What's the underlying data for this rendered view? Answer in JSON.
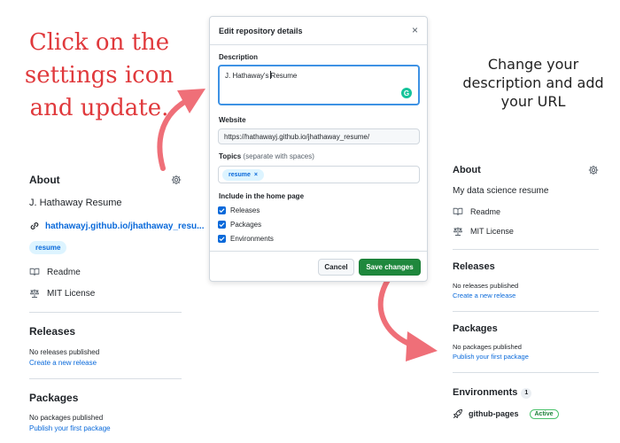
{
  "annotations": {
    "left_instruction": "Click on the settings icon and update.",
    "right_instruction": "Change your description and add your URL"
  },
  "left_sidebar": {
    "about": {
      "heading": "About",
      "description": "J. Hathaway Resume",
      "website": "hathawayj.github.io/jhathaway_resu...",
      "topic": "resume",
      "readme": "Readme",
      "license": "MIT License"
    },
    "releases": {
      "heading": "Releases",
      "empty": "No releases published",
      "link": "Create a new release"
    },
    "packages": {
      "heading": "Packages",
      "empty": "No packages published",
      "link": "Publish your first package"
    }
  },
  "dialog": {
    "title": "Edit repository details",
    "description_label": "Description",
    "description_value_before_caret": "J. Hathaway's",
    "description_value_after_caret": "Resume",
    "grammarly_glyph": "G",
    "website_label": "Website",
    "website_value": "https://hathawayj.github.io/jhathaway_resume/",
    "topics_label": "Topics",
    "topics_hint": "(separate with spaces)",
    "topics": [
      "resume"
    ],
    "topic_remove_glyph": "×",
    "include_label": "Include in the home page",
    "checkboxes": [
      {
        "label": "Releases",
        "checked": true
      },
      {
        "label": "Packages",
        "checked": true
      },
      {
        "label": "Environments",
        "checked": true
      }
    ],
    "cancel_label": "Cancel",
    "save_label": "Save changes",
    "close_glyph": "×"
  },
  "right_sidebar": {
    "about": {
      "heading": "About",
      "description": "My data science resume",
      "readme": "Readme",
      "license": "MIT License"
    },
    "releases": {
      "heading": "Releases",
      "empty": "No releases published",
      "link": "Create a new release"
    },
    "packages": {
      "heading": "Packages",
      "empty": "No packages published",
      "link": "Publish your first package"
    },
    "environments": {
      "heading": "Environments",
      "count": "1",
      "name": "github-pages",
      "status": "Active"
    }
  },
  "colors": {
    "annotation_red": "#e0393c",
    "arrow_pink": "#ef6f78",
    "link_blue": "#0969da",
    "save_green": "#1f883d",
    "focus_blue": "#3e92e4"
  }
}
